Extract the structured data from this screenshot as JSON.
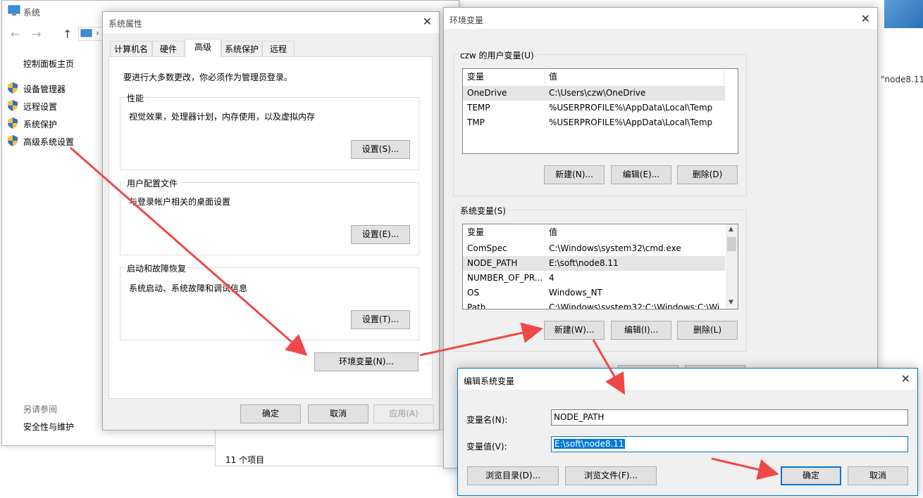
{
  "system_window": {
    "title": "系统",
    "nav": {
      "back": "←",
      "forward": "→",
      "up": "↑",
      "dropdown": "›"
    },
    "sidebar": {
      "home": "控制面板主页",
      "items": [
        {
          "label": "设备管理器",
          "icon": "shield-icon"
        },
        {
          "label": "远程设置",
          "icon": "shield-icon"
        },
        {
          "label": "系统保护",
          "icon": "shield-icon"
        },
        {
          "label": "高级系统设置",
          "icon": "shield-icon"
        }
      ],
      "see_also": "另请参阅",
      "security_link": "安全性与维护"
    }
  },
  "background_window": {
    "status_items": "11 个项目",
    "right_fragment": "\"node8.11"
  },
  "sys_props": {
    "title": "系统属性",
    "tabs": [
      "计算机名",
      "硬件",
      "高级",
      "系统保护",
      "远程"
    ],
    "selected_tab": "高级",
    "admin_note": "要进行大多数更改，你必须作为管理员登录。",
    "performance": {
      "label": "性能",
      "desc": "视觉效果，处理器计划，内存使用，以及虚拟内存",
      "button": "设置(S)..."
    },
    "profiles": {
      "label": "用户配置文件",
      "desc": "与登录帐户相关的桌面设置",
      "button": "设置(E)..."
    },
    "startup": {
      "label": "启动和故障恢复",
      "desc": "系统启动、系统故障和调试信息",
      "button": "设置(T)..."
    },
    "env_button": "环境变量(N)...",
    "ok": "确定",
    "cancel": "取消",
    "apply": "应用(A)"
  },
  "env_vars": {
    "title": "环境变量",
    "user_group": "czw 的用户变量(U)",
    "columns": [
      "变量",
      "值"
    ],
    "user_vars": [
      {
        "name": "OneDrive",
        "value": "C:\\Users\\czw\\OneDrive"
      },
      {
        "name": "TEMP",
        "value": "%USERPROFILE%\\AppData\\Local\\Temp"
      },
      {
        "name": "TMP",
        "value": "%USERPROFILE%\\AppData\\Local\\Temp"
      }
    ],
    "user_buttons": {
      "new": "新建(N)...",
      "edit": "编辑(E)...",
      "delete": "删除(D)"
    },
    "system_group": "系统变量(S)",
    "system_vars": [
      {
        "name": "ComSpec",
        "value": "C:\\Windows\\system32\\cmd.exe"
      },
      {
        "name": "NODE_PATH",
        "value": "E:\\soft\\node8.11"
      },
      {
        "name": "NUMBER_OF_PR...",
        "value": "4"
      },
      {
        "name": "OS",
        "value": "Windows_NT"
      },
      {
        "name": "Path",
        "value": "C:\\Windows\\system32;C:\\Windows;C:\\Wi"
      }
    ],
    "system_buttons": {
      "new": "新建(W)...",
      "edit": "编辑(I)...",
      "delete": "删除(L)"
    }
  },
  "edit_dialog": {
    "title": "编辑系统变量",
    "name_label": "变量名(N):",
    "name_value": "NODE_PATH",
    "value_label": "变量值(V):",
    "value_value": "E:\\soft\\node8.11",
    "browse_dir": "浏览目录(D)...",
    "browse_file": "浏览文件(F)...",
    "ok": "确定",
    "cancel": "取消"
  },
  "colors": {
    "accent": "#0078d7",
    "selection": "#0078d7",
    "arrow": "#f04848",
    "row_highlight": "#e5e5e5"
  }
}
